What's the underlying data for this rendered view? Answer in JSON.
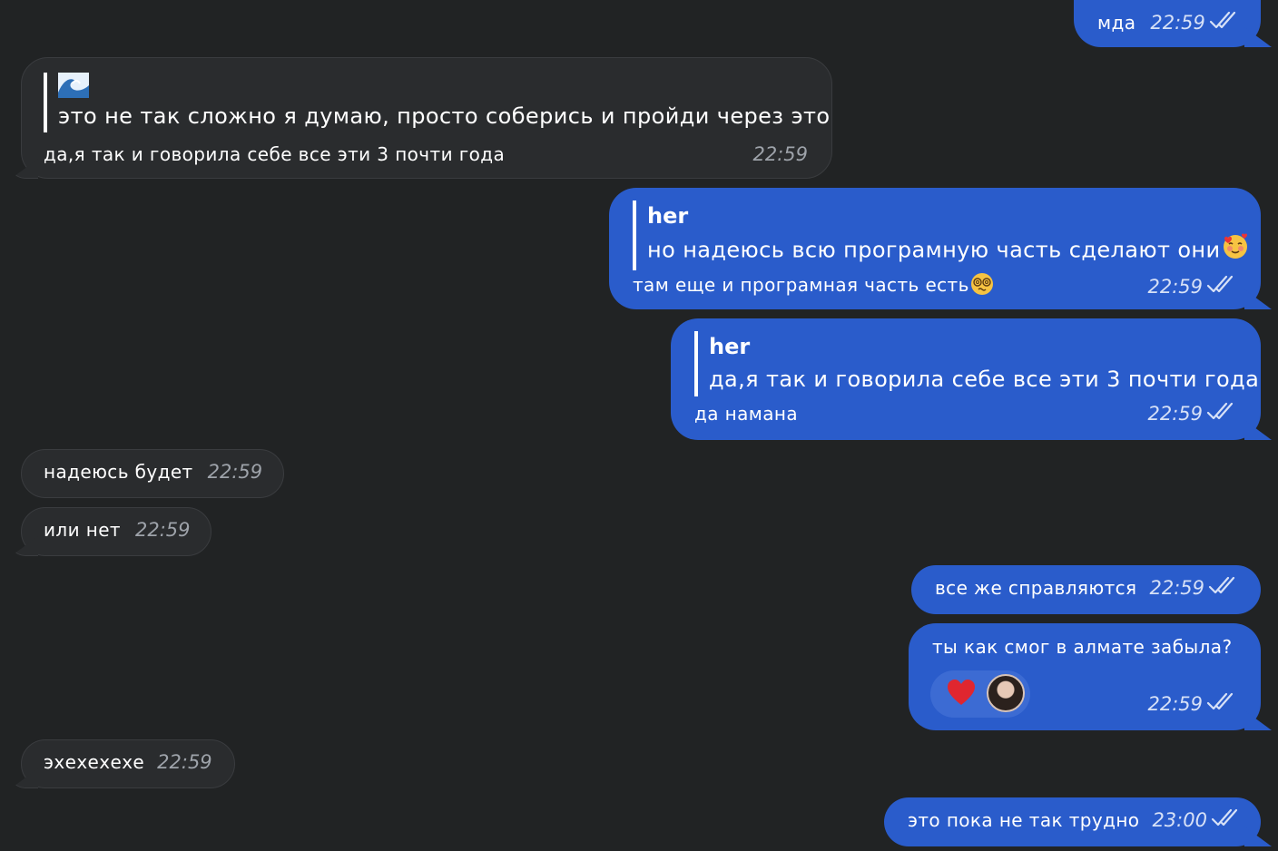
{
  "colors": {
    "background": "#212324",
    "incoming_bubble": "#2a2c2e",
    "outgoing_bubble": "#2a5ccb",
    "accent_text": "#ffffff"
  },
  "messages": [
    {
      "id": "m1",
      "direction": "out",
      "text": "мда",
      "time": "22:59",
      "status": "read-double-check-icon"
    },
    {
      "id": "m2",
      "direction": "in",
      "reply_to_emoji": "wave-emoji-icon",
      "reply_text": "это не так сложно я думаю, просто соберись и пройди через это",
      "text": "да,я так и говорила себе все эти 3 почти года",
      "time": "22:59"
    },
    {
      "id": "m3",
      "direction": "out",
      "reply_author": "her",
      "reply_text": "но надеюсь всю програмную часть сделают они",
      "reply_emoji": "smiling-hearts-emoji-icon",
      "text": "там еще и програмная часть есть",
      "text_emoji": "dizzy-face-emoji-icon",
      "time": "22:59",
      "status": "read-double-check-icon"
    },
    {
      "id": "m4",
      "direction": "out",
      "reply_author": "her",
      "reply_text": "да,я так и говорила себе все эти 3 почти года",
      "text": "да намана",
      "time": "22:59",
      "status": "read-double-check-icon"
    },
    {
      "id": "m5",
      "direction": "in",
      "text": "надеюсь будет",
      "time": "22:59"
    },
    {
      "id": "m6",
      "direction": "in",
      "text": "или нет",
      "time": "22:59"
    },
    {
      "id": "m7",
      "direction": "out",
      "text": "все же справляются",
      "time": "22:59",
      "status": "read-double-check-icon"
    },
    {
      "id": "m8",
      "direction": "out",
      "text": "ты как смог в алмате забыла?",
      "time": "22:59",
      "status": "read-double-check-icon",
      "reaction": "red-heart-icon",
      "reactor_avatar": "user-avatar"
    },
    {
      "id": "m9",
      "direction": "in",
      "text": "эхехехехе",
      "time": "22:59"
    },
    {
      "id": "m10",
      "direction": "out",
      "text": "это пока не так трудно",
      "time": "23:00",
      "status": "read-double-check-icon"
    }
  ]
}
